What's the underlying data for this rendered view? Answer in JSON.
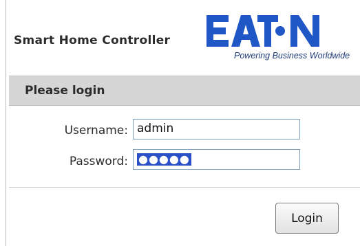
{
  "header": {
    "title": "Smart Home Controller",
    "logo": {
      "wordmark": "EATON",
      "tagline": "Powering Business Worldwide",
      "brand_color": "#1f57c7"
    }
  },
  "login_panel": {
    "heading": "Please login",
    "username_label": "Username:",
    "username_value": "admin",
    "password_label": "Password:",
    "password_masked": "●●●●●",
    "submit_label": "Login"
  },
  "colors": {
    "header_bar": "#d6d6d6",
    "input_border": "#7b9ebd",
    "selection": "#2a50c8"
  }
}
